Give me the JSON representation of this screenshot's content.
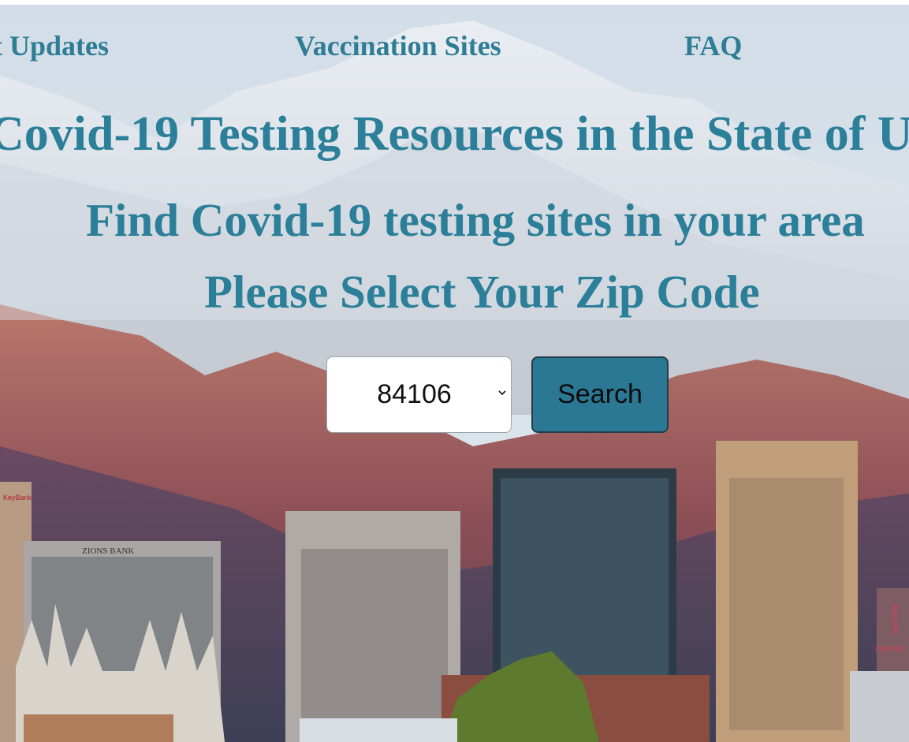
{
  "nav": {
    "item_1": "t Updates",
    "item_2": "Vaccination Sites",
    "item_3": "FAQ"
  },
  "headings": {
    "title": "Covid-19 Testing Resources in the State of U",
    "subtitle": "Find Covid-19 testing sites in your area",
    "prompt": "Please Select Your Zip Code"
  },
  "form": {
    "zip_selected": "84106",
    "search_label": "Search"
  },
  "background": {
    "building_sign_1": "KeyBank",
    "building_sign_2": "ZIONS BANK",
    "building_sign_3": "WALKER",
    "building_sign_4": "CENTER"
  },
  "colors": {
    "heading": "#2b7f99",
    "button": "#2a7893"
  }
}
